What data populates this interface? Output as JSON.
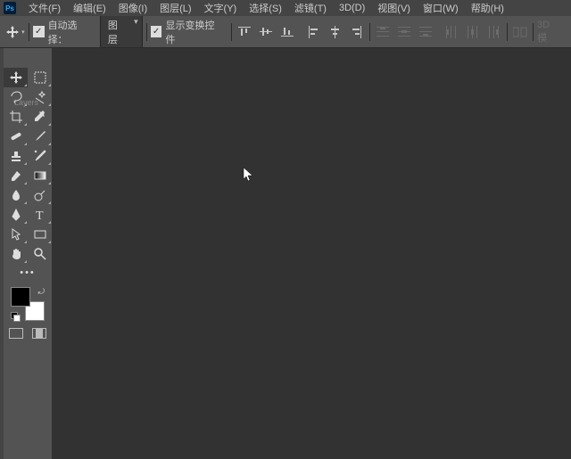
{
  "menu": {
    "items": [
      "文件(F)",
      "编辑(E)",
      "图像(I)",
      "图层(L)",
      "文字(Y)",
      "选择(S)",
      "滤镜(T)",
      "3D(D)",
      "视图(V)",
      "窗口(W)",
      "帮助(H)"
    ]
  },
  "options": {
    "auto_select_label": "自动选择：",
    "auto_select_target": "图层",
    "show_transform_label": "显示变换控件",
    "trailing_label": "3D 模"
  },
  "panels": {
    "layers_tab": "Layers"
  },
  "swatches": {
    "fg": "#000000",
    "bg": "#ffffff"
  }
}
